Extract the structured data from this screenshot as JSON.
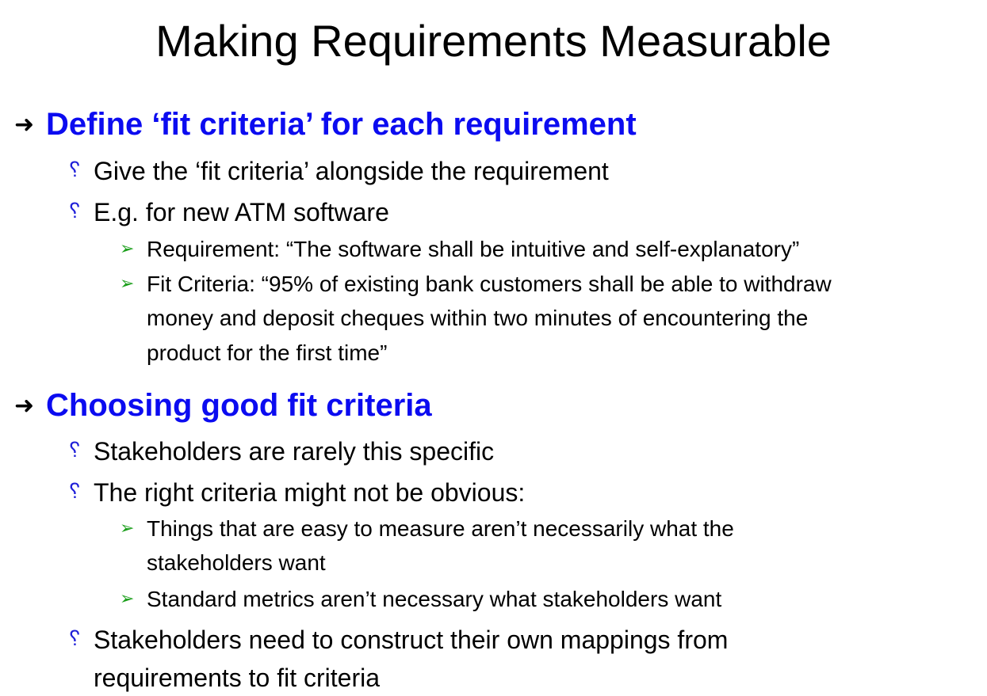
{
  "title": "Making Requirements Measurable",
  "markers": {
    "level1": "➜",
    "level2": "␦",
    "level3": "➢"
  },
  "colors": {
    "heading": "#0b0bf0",
    "level3_bullet": "#1a9e1a"
  },
  "sections": [
    {
      "heading": "Define ‘fit criteria’ for each requirement",
      "items": [
        {
          "text": "Give the ‘fit criteria’ alongside the requirement"
        },
        {
          "text": "E.g. for new ATM software",
          "subitems": [
            {
              "lines": [
                "Requirement: “The software shall be intuitive and self-explanatory”"
              ]
            },
            {
              "lines": [
                "Fit Criteria: “95% of existing bank customers shall be able to withdraw",
                "money and deposit cheques within two minutes of encountering the",
                "product for the first time”"
              ]
            }
          ]
        }
      ]
    },
    {
      "heading": "Choosing good fit criteria",
      "items": [
        {
          "text": "Stakeholders are rarely this specific"
        },
        {
          "text": "The right criteria might not be obvious:",
          "subitems": [
            {
              "lines": [
                "Things that are easy to measure aren’t necessarily what the",
                "stakeholders want"
              ]
            },
            {
              "lines": [
                "Standard metrics aren’t necessary what stakeholders want"
              ]
            }
          ]
        },
        {
          "lines": [
            "Stakeholders need to construct their own mappings from",
            "requirements to fit criteria"
          ]
        }
      ]
    }
  ]
}
